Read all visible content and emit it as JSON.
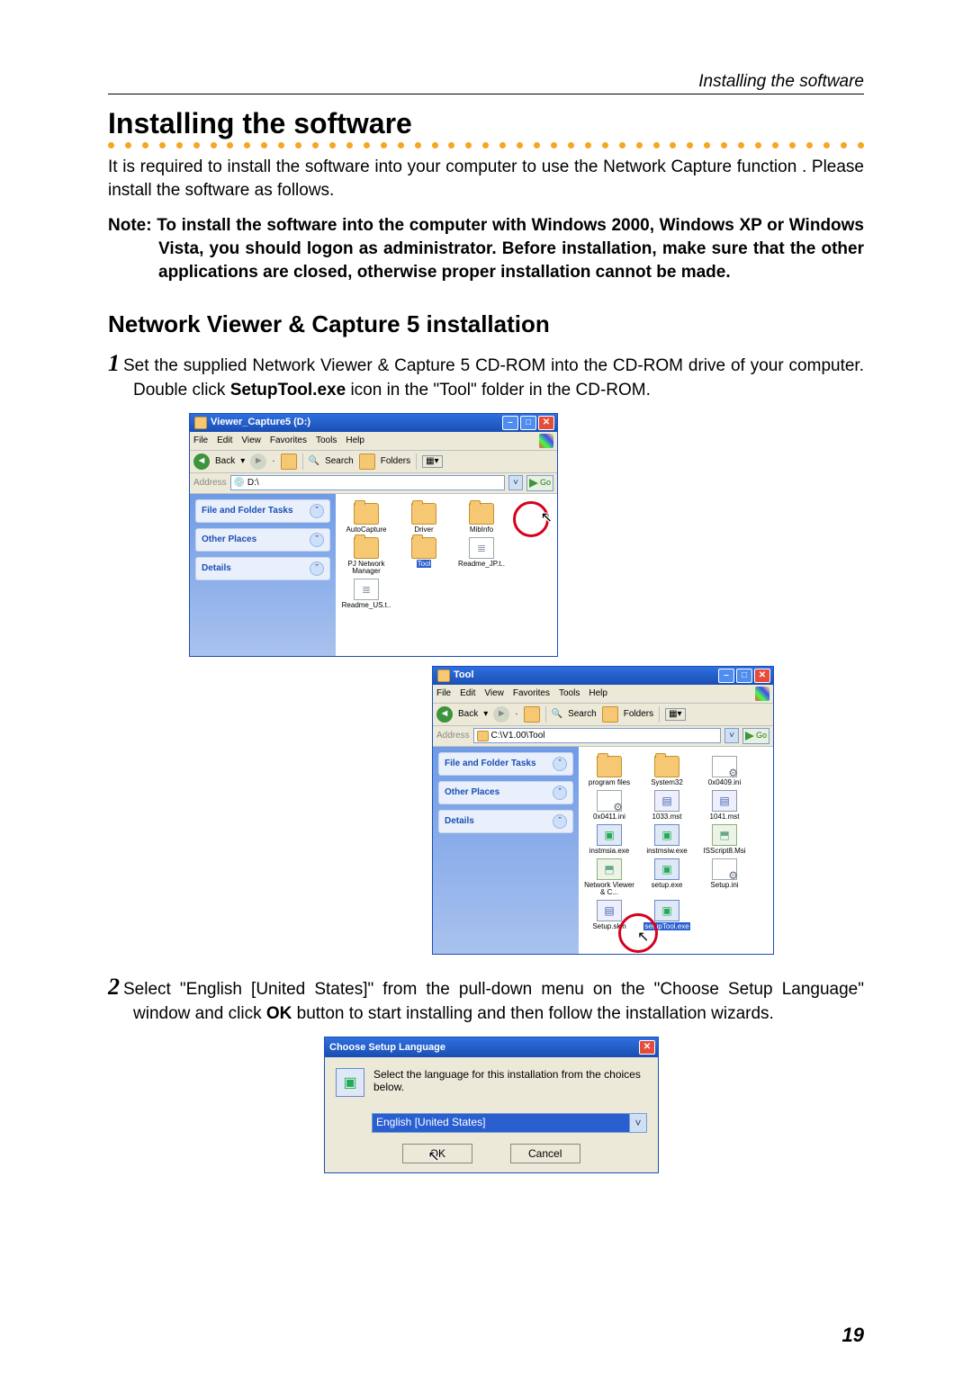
{
  "header": {
    "running": "Installing the software"
  },
  "title": "Installing the software",
  "para1": "It is required to install the software into your computer to use the Network Capture function . Please install the software as follows.",
  "note_label": "Note: ",
  "note_body": "To install the software into the computer with Windows 2000, Windows XP or Windows Vista, you should logon as administrator. Before installation, make sure that the other applications are closed, otherwise proper installation cannot be made.",
  "h2": "Network Viewer & Capture 5 installation",
  "step1a": "Set the supplied Network Viewer & Capture 5 CD-ROM into the CD-ROM drive of your computer. Double click ",
  "step1b": "SetupTool.exe",
  "step1c": " icon in the \"Tool\" folder in the CD-ROM.",
  "step2a": "Select \"English [United States]\" from the pull-down menu on the \"Choose Setup Language\" window and click ",
  "step2b": "OK",
  "step2c": " button to start installing and then follow the installation wizards.",
  "win1": {
    "title": "Viewer_Capture5 (D:)",
    "menu": [
      "File",
      "Edit",
      "View",
      "Favorites",
      "Tools",
      "Help"
    ],
    "back": "Back",
    "search": "Search",
    "folders": "Folders",
    "addr_label": "Address",
    "addr": "D:\\",
    "go": "Go",
    "tasks": [
      "File and Folder Tasks",
      "Other Places",
      "Details"
    ],
    "items": [
      {
        "label": "AutoCapture",
        "type": "folder"
      },
      {
        "label": "Driver",
        "type": "folder"
      },
      {
        "label": "MibInfo",
        "type": "folder"
      },
      {
        "label": "PJ Network Manager",
        "type": "folder"
      },
      {
        "label": "Tool",
        "type": "folder",
        "hl": true
      },
      {
        "label": "Readme_JP.t..",
        "type": "txt"
      },
      {
        "label": "Readme_US.t..",
        "type": "txt"
      }
    ]
  },
  "win2": {
    "title": "Tool",
    "menu": [
      "File",
      "Edit",
      "View",
      "Favorites",
      "Tools",
      "Help"
    ],
    "back": "Back",
    "search": "Search",
    "folders": "Folders",
    "addr_label": "Address",
    "addr": "C:\\V1.00\\Tool",
    "go": "Go",
    "tasks": [
      "File and Folder Tasks",
      "Other Places",
      "Details"
    ],
    "items": [
      {
        "label": "program files",
        "type": "folder"
      },
      {
        "label": "System32",
        "type": "folder"
      },
      {
        "label": "0x0409.ini",
        "type": "ini"
      },
      {
        "label": "0x0411.ini",
        "type": "ini"
      },
      {
        "label": "1033.mst",
        "type": "mst"
      },
      {
        "label": "1041.mst",
        "type": "mst"
      },
      {
        "label": "instmsia.exe",
        "type": "exe"
      },
      {
        "label": "instmsiw.exe",
        "type": "exe"
      },
      {
        "label": "ISScript8.Msi",
        "type": "msi"
      },
      {
        "label": "Network Viewer & C...",
        "type": "msi"
      },
      {
        "label": "setup.exe",
        "type": "exe"
      },
      {
        "label": "Setup.ini",
        "type": "ini"
      },
      {
        "label": "Setup.skin",
        "type": "skn"
      },
      {
        "label": "setupTool.exe",
        "type": "exe",
        "hl": true
      }
    ]
  },
  "dlg": {
    "title": "Choose Setup Language",
    "msg": "Select the language for this installation from the choices below.",
    "value": "English [United States]",
    "ok": "OK",
    "cancel": "Cancel"
  },
  "pagenum": "19"
}
